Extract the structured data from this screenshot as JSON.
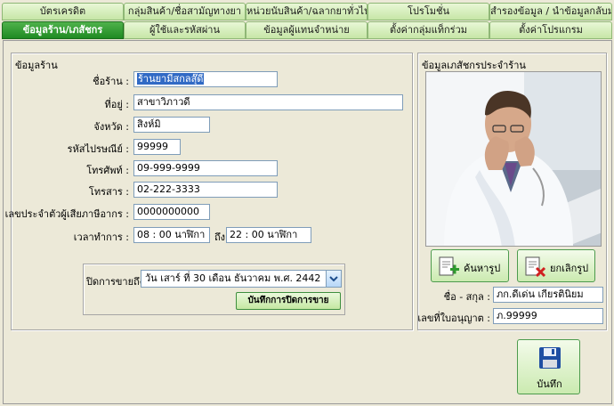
{
  "tabs_row1": [
    "บัตรเครดิต",
    "กลุ่มสินค้า/ชื่อสามัญทางยา",
    "หน่วยนับสินค้า/ฉลากยาทั่วไป",
    "โปรโมชั่น",
    "สำรองข้อมูล / นำข้อมูลกลับมา"
  ],
  "tabs_row2": [
    "ข้อมูลร้าน/เภสัชกร",
    "ผู้ใช้และรหัสผ่าน",
    "ข้อมูลผู้แทนจำหน่าย",
    "ตั้งค่ากลุ่มแท็กร่วม",
    "ตั้งค่าโปรแกรม"
  ],
  "store": {
    "title": "ข้อมูลร้าน",
    "name_label": "ชื่อร้าน :",
    "name_value": "ร้านยามีสกลสุ๊ดี",
    "address_label": "ที่อยู่ :",
    "address_value": "สาขาวิภาวดี",
    "province_label": "จังหวัด :",
    "province_value": "สิงห์มิ",
    "postcode_label": "รหัสไปรษณีย์ :",
    "postcode_value": "99999",
    "phone_label": "โทรศัพท์ :",
    "phone_value": "09-999-9999",
    "fax_label": "โทรสาร :",
    "fax_value": "02-222-3333",
    "taxid_label": "เลขประจำตัวผู้เสียภาษีอากร :",
    "taxid_value": "0000000000",
    "hours_label": "เวลาทำการ :",
    "open_value": "08 : 00 นาฬิกา",
    "to_label": "ถึง",
    "close_value": "22 : 00 นาฬิกา"
  },
  "closing": {
    "label": "ปิดการขายถึง",
    "date_value": "วัน  เสาร์  ที่ 30 เดือน  ธันวาคม  พ.ศ.  2442",
    "save_label": "บันทึกการปิดการขาย"
  },
  "pharmacist": {
    "title": "ข้อมูลเภสัชกรประจำร้าน",
    "search_label": "ค้นหารูป",
    "cancel_label": "ยกเลิกรูป",
    "name_label": "ชื่อ - สกุล :",
    "name_value": "ภก.ดีเด่น  เกียรตินิยม",
    "license_label": "เลขที่ใบอนุญาต :",
    "license_value": "ภ.99999"
  },
  "save_label": "บันทึก",
  "icons": [
    "search-image-icon",
    "cancel-image-icon",
    "floppy-disk-icon",
    "dropdown-arrow-icon"
  ]
}
